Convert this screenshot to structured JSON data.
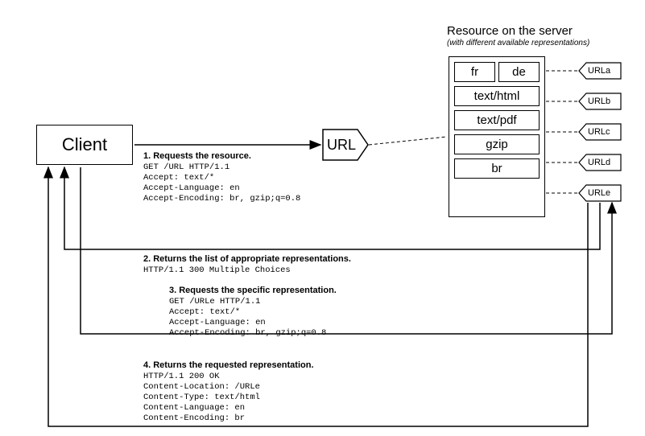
{
  "client_label": "Client",
  "url_label": "URL",
  "server_title": "Resource on the server",
  "server_subtitle": "(with different available representations)",
  "reps": {
    "row1a": "fr",
    "row1b": "de",
    "row2": "text/html",
    "row3": "text/pdf",
    "row4": "gzip",
    "row5": "br"
  },
  "url_chips": {
    "a": "URLa",
    "b": "URLb",
    "c": "URLc",
    "d": "URLd",
    "e": "URLe"
  },
  "msg1": {
    "title": "1. Requests the resource.",
    "l1": "GET /URL HTTP/1.1",
    "l2": "Accept: text/*",
    "l3": "Accept-Language: en",
    "l4": "Accept-Encoding: br, gzip;q=0.8"
  },
  "msg2": {
    "title": "2. Returns the list of appropriate representations.",
    "l1": "HTTP/1.1 300 Multiple Choices"
  },
  "msg3": {
    "title": "3. Requests the specific representation.",
    "l1": "GET /URLe HTTP/1.1",
    "l2": "Accept: text/*",
    "l3": "Accept-Language: en",
    "l4": "Accept-Encoding: br, gzip;q=0.8"
  },
  "msg4": {
    "title": "4. Returns the requested representation.",
    "l1": "HTTP/1.1 200 OK",
    "l2": "Content-Location: /URLe",
    "l3": "Content-Type: text/html",
    "l4": "Content-Language: en",
    "l5": "Content-Encoding: br"
  }
}
